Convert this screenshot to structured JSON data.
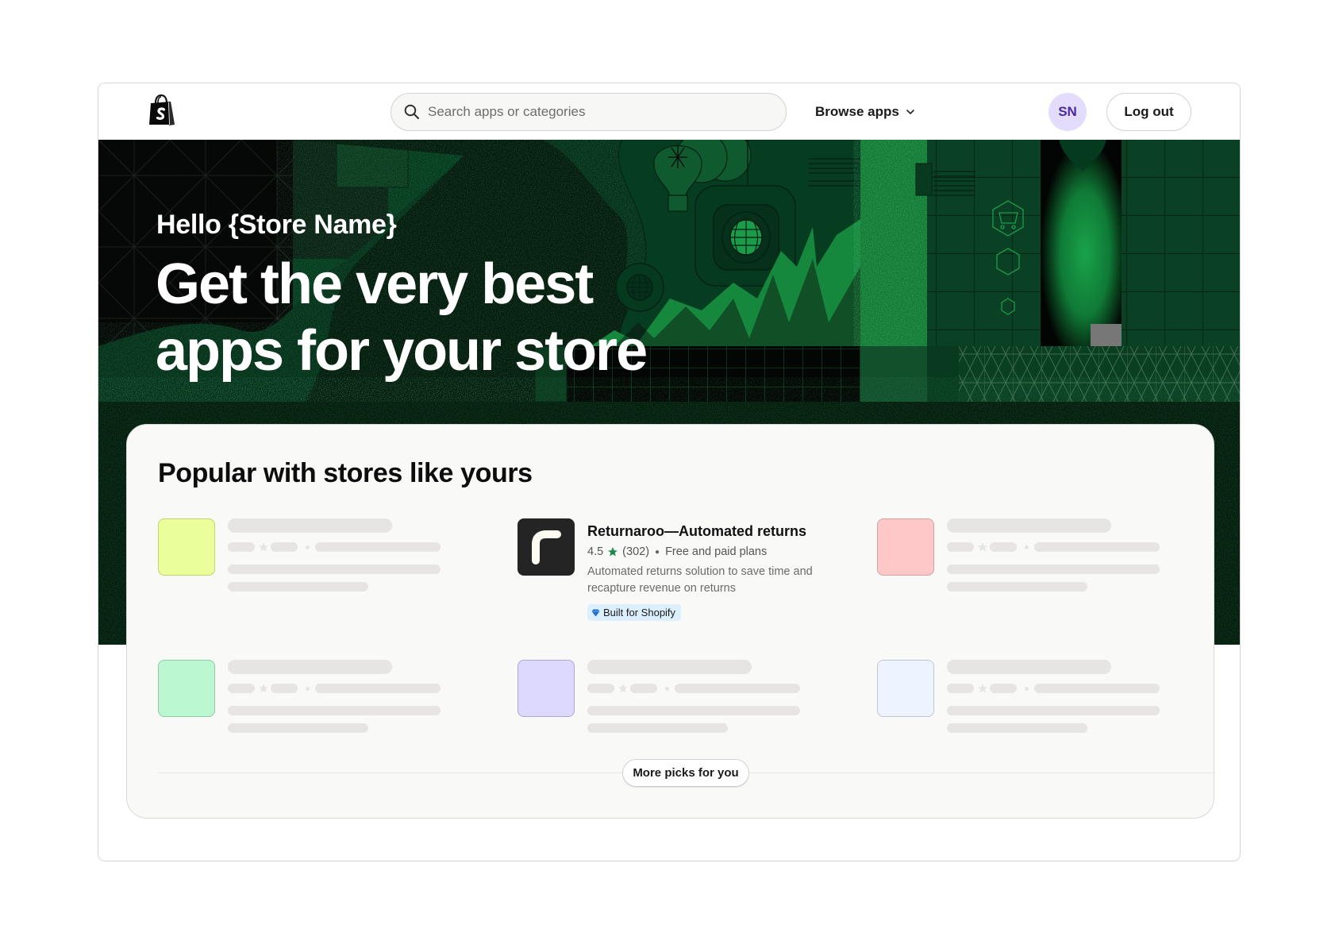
{
  "header": {
    "logo": "shopify-bag-icon",
    "search": {
      "placeholder": "Search apps or categories",
      "value": ""
    },
    "browse_label": "Browse apps",
    "avatar_initials": "SN",
    "logout_label": "Log out"
  },
  "hero": {
    "greeting": "Hello {Store Name}",
    "headline_line1": "Get the very best",
    "headline_line2": "apps for your store"
  },
  "popular": {
    "title": "Popular with stores like yours",
    "featured_app": {
      "name": "Returnaroo—Automated returns",
      "rating": "4.5",
      "review_count": "(302)",
      "pricing": "Free and paid plans",
      "description": "Automated returns solution to save time and recapture revenue on returns",
      "badge": "Built for Shopify",
      "icon": "returnaroo-logo-icon"
    },
    "placeholders": [
      {
        "position": "row1-col1",
        "color": "#ebfe9c",
        "border": "#c4d46a"
      },
      {
        "position": "row1-col3",
        "color": "#ffc8c8",
        "border": "#d8a0a0"
      },
      {
        "position": "row2-col1",
        "color": "#bbf7d0",
        "border": "#8fcca4"
      },
      {
        "position": "row2-col2",
        "color": "#ddd8fd",
        "border": "#aea6d8"
      },
      {
        "position": "row2-col3",
        "color": "#eef4ff",
        "border": "#bfc6d4"
      }
    ],
    "more_label": "More picks for you"
  },
  "colors": {
    "hero_green": "#063a1f",
    "accent_green": "#16a34a",
    "avatar_bg": "#e3dcfc",
    "avatar_text": "#4b2a9c",
    "badge_bg": "#dcefff"
  }
}
